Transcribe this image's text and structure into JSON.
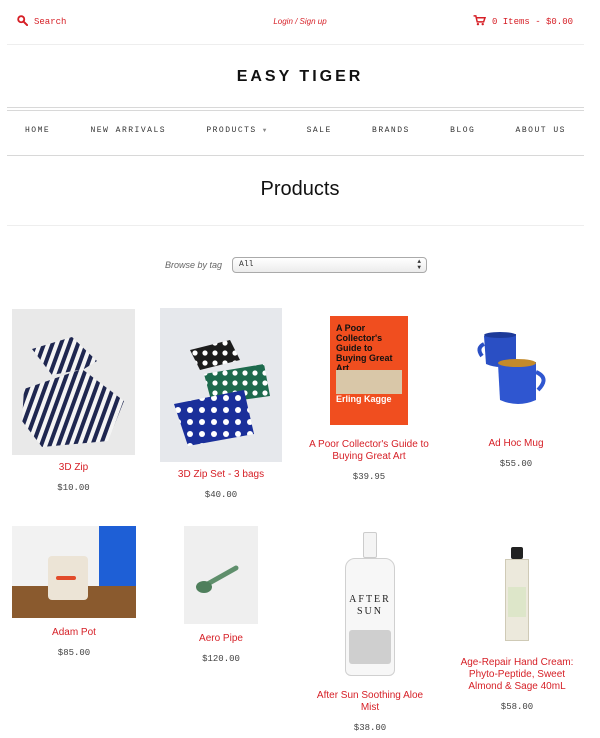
{
  "header": {
    "search_label": "Search",
    "login_label": "Login / Sign up",
    "cart_label": "0 Items - $0.00"
  },
  "logo": "EASY TIGER",
  "nav": {
    "items": [
      "HOME",
      "NEW ARRIVALS",
      "PRODUCTS",
      "SALE",
      "BRANDS",
      "BLOG",
      "ABOUT US"
    ]
  },
  "page_title": "Products",
  "filter": {
    "label": "Browse by tag",
    "selected": "All"
  },
  "products": [
    {
      "name": "3D Zip",
      "price": "$10.00"
    },
    {
      "name": "3D Zip Set - 3 bags",
      "price": "$40.00"
    },
    {
      "name": "A Poor Collector's Guide to Buying Great Art",
      "price": "$39.95"
    },
    {
      "name": "Ad Hoc Mug",
      "price": "$55.00"
    },
    {
      "name": "Adam Pot",
      "price": "$85.00"
    },
    {
      "name": "Aero Pipe",
      "price": "$120.00"
    },
    {
      "name": "After Sun Soothing Aloe Mist",
      "price": "$38.00"
    },
    {
      "name": "Age-Repair Hand Cream: Phyto-Peptide, Sweet Almond & Sage 40mL",
      "price": "$58.00"
    }
  ],
  "book_cover_text": "A Poor Collector's Guide to Buying Great Art",
  "book_author_text": "Erling Kagge",
  "bottle_label_text": "AFTER SUN",
  "colors": {
    "accent": "#d61f26",
    "book_orange": "#f04e1f",
    "mug_blue": "#2a4fc4"
  }
}
